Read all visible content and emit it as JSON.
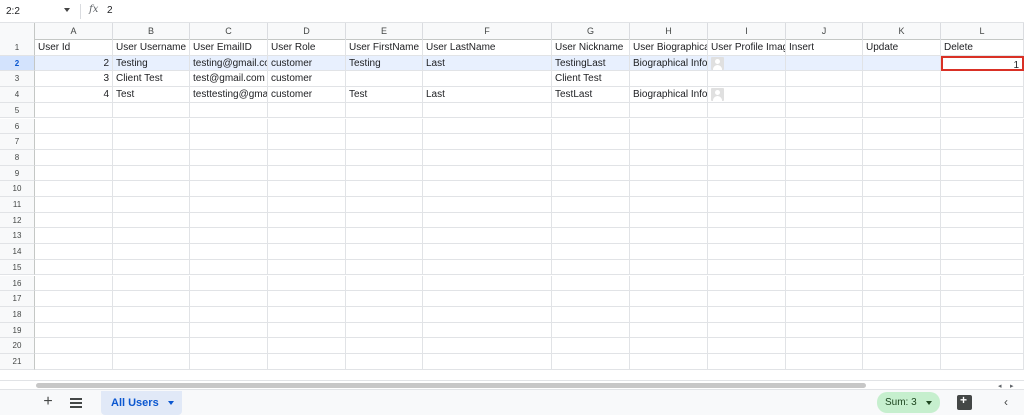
{
  "formula_bar": {
    "name_box": "2:2",
    "fx_label": "fx",
    "value": "2"
  },
  "columns": [
    "A",
    "B",
    "C",
    "D",
    "E",
    "F",
    "G",
    "H",
    "I",
    "J",
    "K",
    "L"
  ],
  "rows": [
    {
      "num": "1",
      "cells": [
        "User Id",
        "User Username",
        "User EmailID",
        "User Role",
        "User FirstName",
        "User LastName",
        "User Nickname",
        "User Biographical",
        "User Profile Imag",
        "Insert",
        "Update",
        "Delete"
      ]
    },
    {
      "num": "2",
      "cells": [
        "2",
        "Testing",
        "testing@gmail.co",
        "customer",
        "Testing",
        "Last",
        "TestingLast",
        "Biographical Info",
        "",
        "",
        "",
        "1"
      ]
    },
    {
      "num": "3",
      "cells": [
        "3",
        "Client Test",
        "test@gmail.com",
        "customer",
        "",
        "",
        "Client Test",
        "",
        "",
        "",
        "",
        ""
      ]
    },
    {
      "num": "4",
      "cells": [
        "4",
        "Test",
        "testtesting@gma",
        "customer",
        "Test",
        "Last",
        "TestLast",
        "Biographical Info",
        "",
        "",
        "",
        ""
      ]
    },
    {
      "num": "5",
      "cells": [
        "",
        "",
        "",
        "",
        "",
        "",
        "",
        "",
        "",
        "",
        "",
        ""
      ]
    },
    {
      "num": "6",
      "cells": [
        "",
        "",
        "",
        "",
        "",
        "",
        "",
        "",
        "",
        "",
        "",
        ""
      ]
    },
    {
      "num": "7",
      "cells": [
        "",
        "",
        "",
        "",
        "",
        "",
        "",
        "",
        "",
        "",
        "",
        ""
      ]
    },
    {
      "num": "8",
      "cells": [
        "",
        "",
        "",
        "",
        "",
        "",
        "",
        "",
        "",
        "",
        "",
        ""
      ]
    },
    {
      "num": "9",
      "cells": [
        "",
        "",
        "",
        "",
        "",
        "",
        "",
        "",
        "",
        "",
        "",
        ""
      ]
    },
    {
      "num": "10",
      "cells": [
        "",
        "",
        "",
        "",
        "",
        "",
        "",
        "",
        "",
        "",
        "",
        ""
      ]
    },
    {
      "num": "11",
      "cells": [
        "",
        "",
        "",
        "",
        "",
        "",
        "",
        "",
        "",
        "",
        "",
        ""
      ]
    },
    {
      "num": "12",
      "cells": [
        "",
        "",
        "",
        "",
        "",
        "",
        "",
        "",
        "",
        "",
        "",
        ""
      ]
    },
    {
      "num": "13",
      "cells": [
        "",
        "",
        "",
        "",
        "",
        "",
        "",
        "",
        "",
        "",
        "",
        ""
      ]
    },
    {
      "num": "14",
      "cells": [
        "",
        "",
        "",
        "",
        "",
        "",
        "",
        "",
        "",
        "",
        "",
        ""
      ]
    },
    {
      "num": "15",
      "cells": [
        "",
        "",
        "",
        "",
        "",
        "",
        "",
        "",
        "",
        "",
        "",
        ""
      ]
    },
    {
      "num": "16",
      "cells": [
        "",
        "",
        "",
        "",
        "",
        "",
        "",
        "",
        "",
        "",
        "",
        ""
      ]
    },
    {
      "num": "17",
      "cells": [
        "",
        "",
        "",
        "",
        "",
        "",
        "",
        "",
        "",
        "",
        "",
        ""
      ]
    },
    {
      "num": "18",
      "cells": [
        "",
        "",
        "",
        "",
        "",
        "",
        "",
        "",
        "",
        "",
        "",
        ""
      ]
    },
    {
      "num": "19",
      "cells": [
        "",
        "",
        "",
        "",
        "",
        "",
        "",
        "",
        "",
        "",
        "",
        ""
      ]
    },
    {
      "num": "20",
      "cells": [
        "",
        "",
        "",
        "",
        "",
        "",
        "",
        "",
        "",
        "",
        "",
        ""
      ]
    },
    {
      "num": "21",
      "cells": [
        "",
        "",
        "",
        "",
        "",
        "",
        "",
        "",
        "",
        "",
        "",
        ""
      ]
    }
  ],
  "selected_row": "2",
  "active_cell": "L2",
  "bottom_bar": {
    "add_sheet_label": "+",
    "sheet_tab_label": "All Users",
    "sum_label": "Sum: 3",
    "collapse_label": "‹"
  },
  "colors": {
    "selection": "#e8f0fe",
    "active_border": "#d93025",
    "sheet_tab": "#0b57d0",
    "sum_badge": "#c6efce"
  }
}
